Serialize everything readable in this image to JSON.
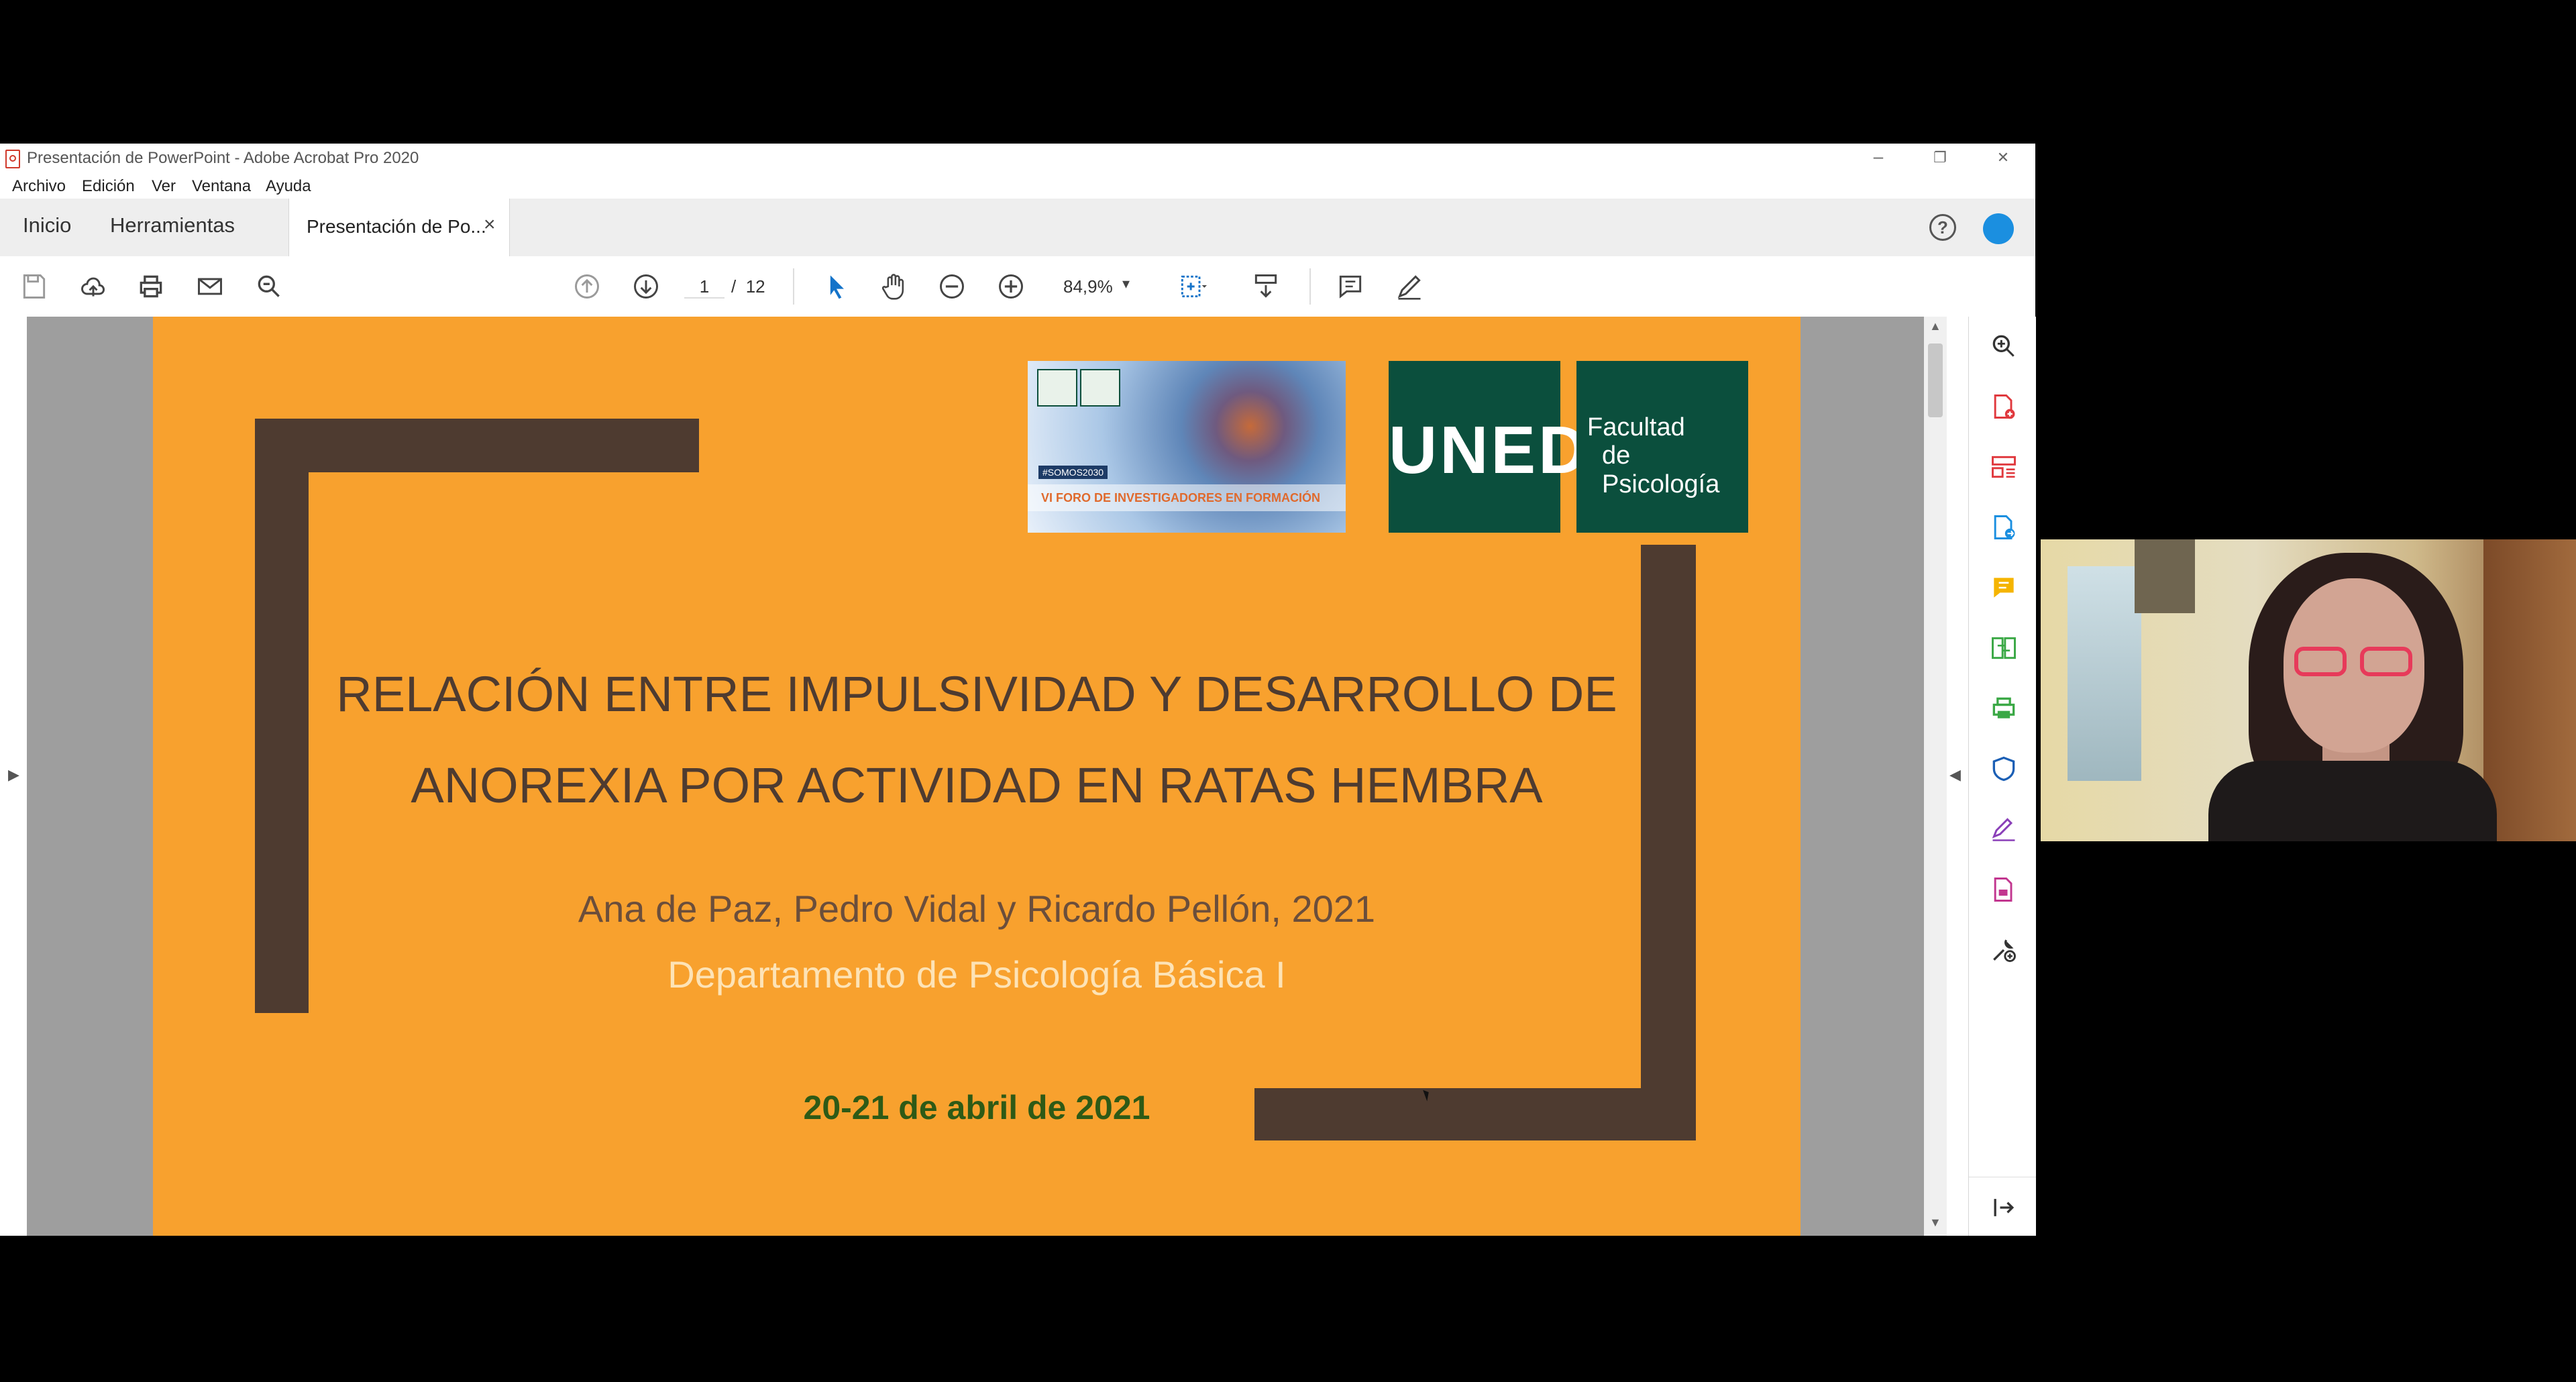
{
  "window": {
    "title": "Presentación de PowerPoint - Adobe Acrobat Pro 2020",
    "controls": {
      "minimize": "–",
      "restore": "❐",
      "close": "✕"
    }
  },
  "menu": [
    "Archivo",
    "Edición",
    "Ver",
    "Ventana",
    "Ayuda"
  ],
  "tabs": {
    "home": "Inicio",
    "tools": "Herramientas",
    "document": "Presentación de Po...",
    "close": "×"
  },
  "toolbar": {
    "page_current": "1",
    "page_separator": "/",
    "page_total": "12",
    "zoom": "84,9%"
  },
  "slide": {
    "title_line1": "RELACIÓN ENTRE IMPULSIVIDAD Y DESARROLLO DE",
    "title_line2": "ANOREXIA POR ACTIVIDAD EN RATAS HEMBRA",
    "authors": "Ana de Paz, Pedro Vidal y Ricardo Pellón, 2021",
    "department": "Departamento de Psicología Básica I",
    "date": "20-21 de abril de 2021",
    "banner_tag": "#SOMOS2030",
    "banner_text": "VI FORO DE INVESTIGADORES EN FORMACIÓN",
    "logo_uned": "UNED",
    "logo_faculty_line1": "Facultad",
    "logo_faculty_line2": "de Psicología"
  },
  "colors": {
    "slide_bg": "#f8a12e",
    "slide_bars": "#4e3b30",
    "uned_green": "#0b4f3d",
    "department_text": "#fde3b6",
    "date_text": "#2e5a16",
    "acrobat_blue": "#1b8fe0"
  }
}
